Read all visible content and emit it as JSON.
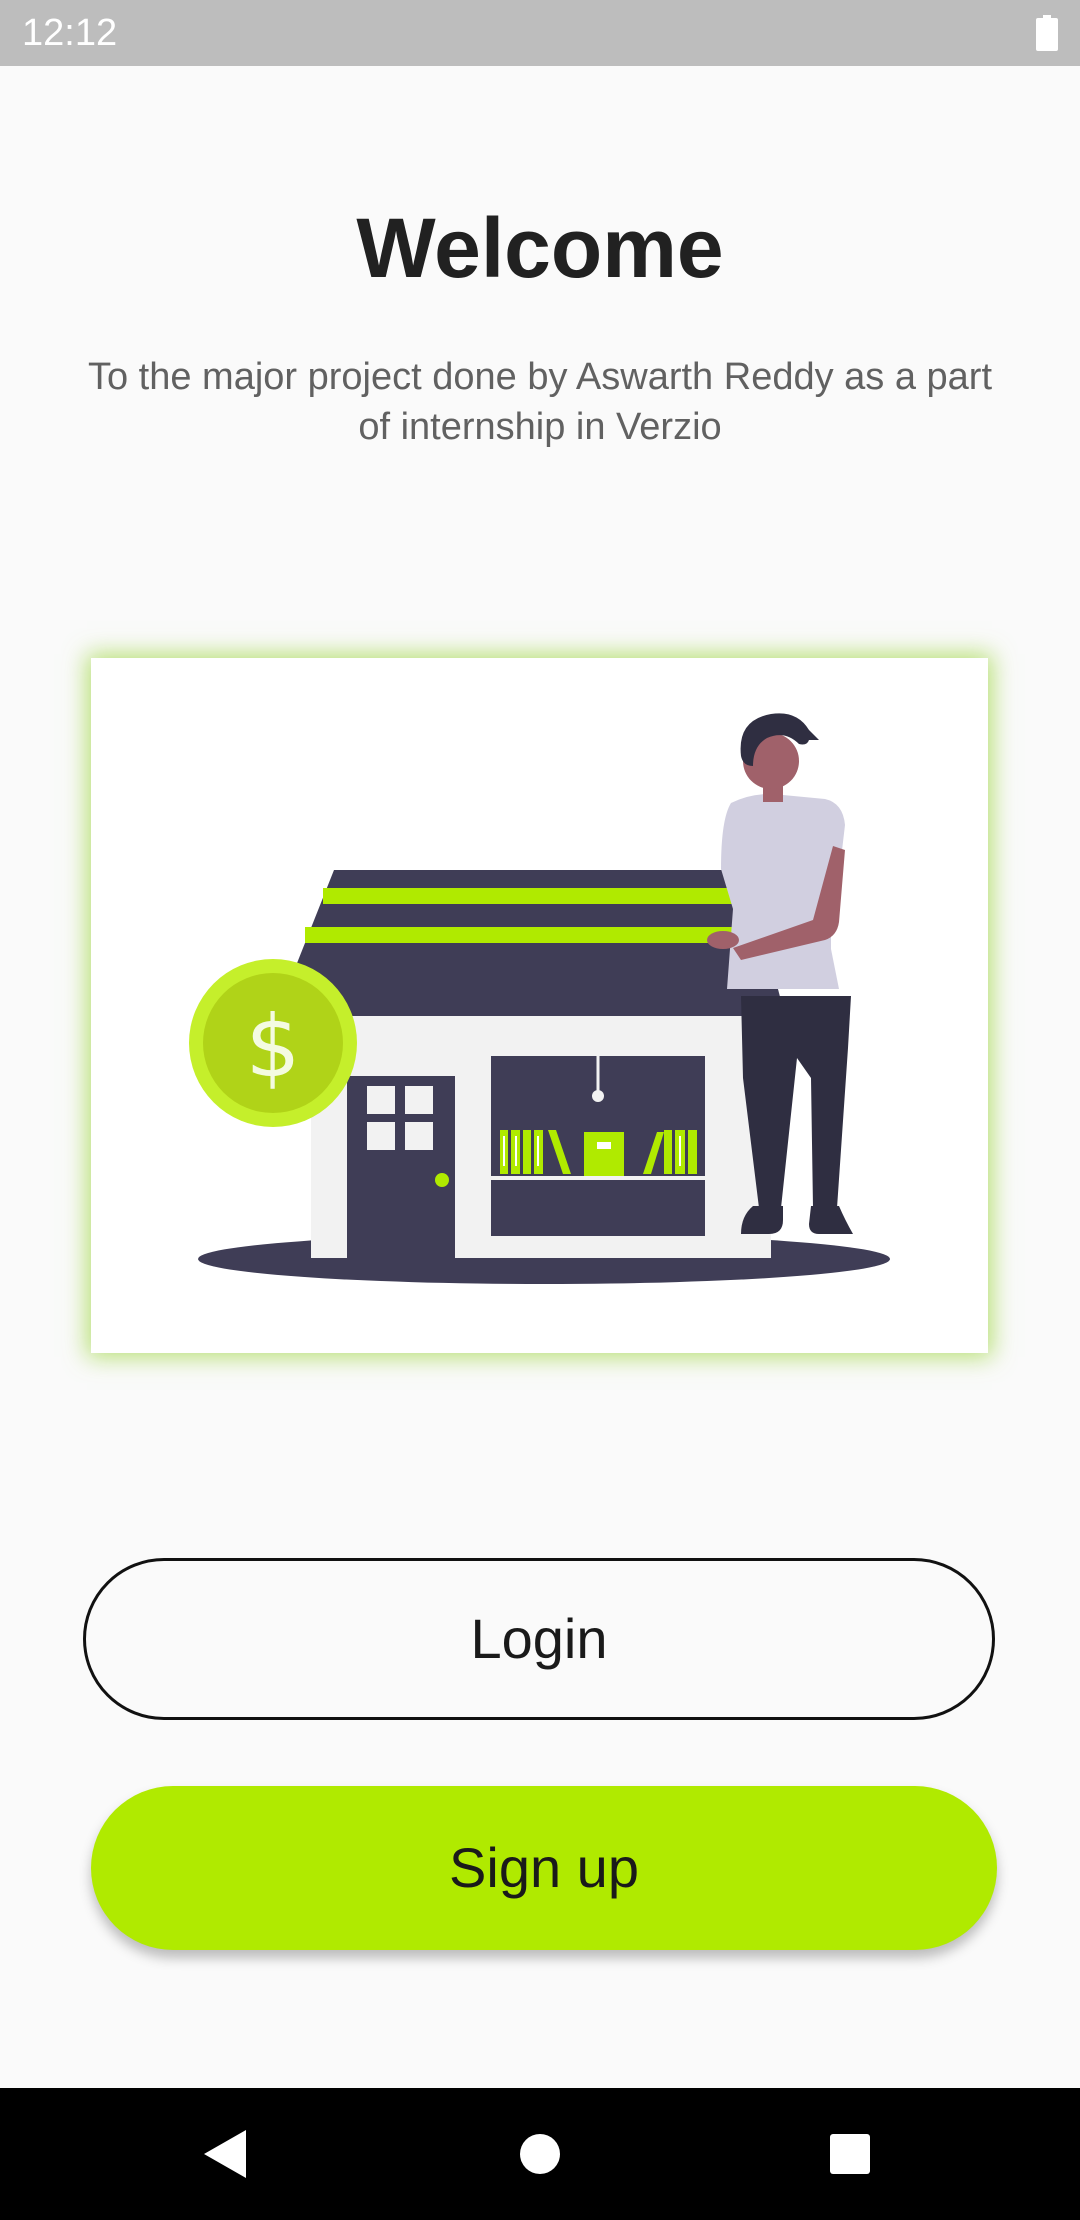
{
  "status_bar": {
    "time": "12:12",
    "battery_icon": "battery-full-icon"
  },
  "welcome": {
    "title": "Welcome",
    "subtitle": "To the major project done by Aswarth Reddy as a part of internship in Verzio"
  },
  "illustration": {
    "description_icon": "shop-with-person-illustration",
    "accent_color": "#b0ea00",
    "dark_color": "#3f3d56"
  },
  "buttons": {
    "login_label": "Login",
    "signup_label": "Sign up"
  },
  "nav_bar": {
    "back_icon": "back-triangle-icon",
    "home_icon": "home-circle-icon",
    "recents_icon": "recents-square-icon"
  },
  "colors": {
    "accent": "#b0ea00",
    "background": "#fafafa",
    "status_bar": "#bdbdbd",
    "nav_bar": "#000000"
  }
}
